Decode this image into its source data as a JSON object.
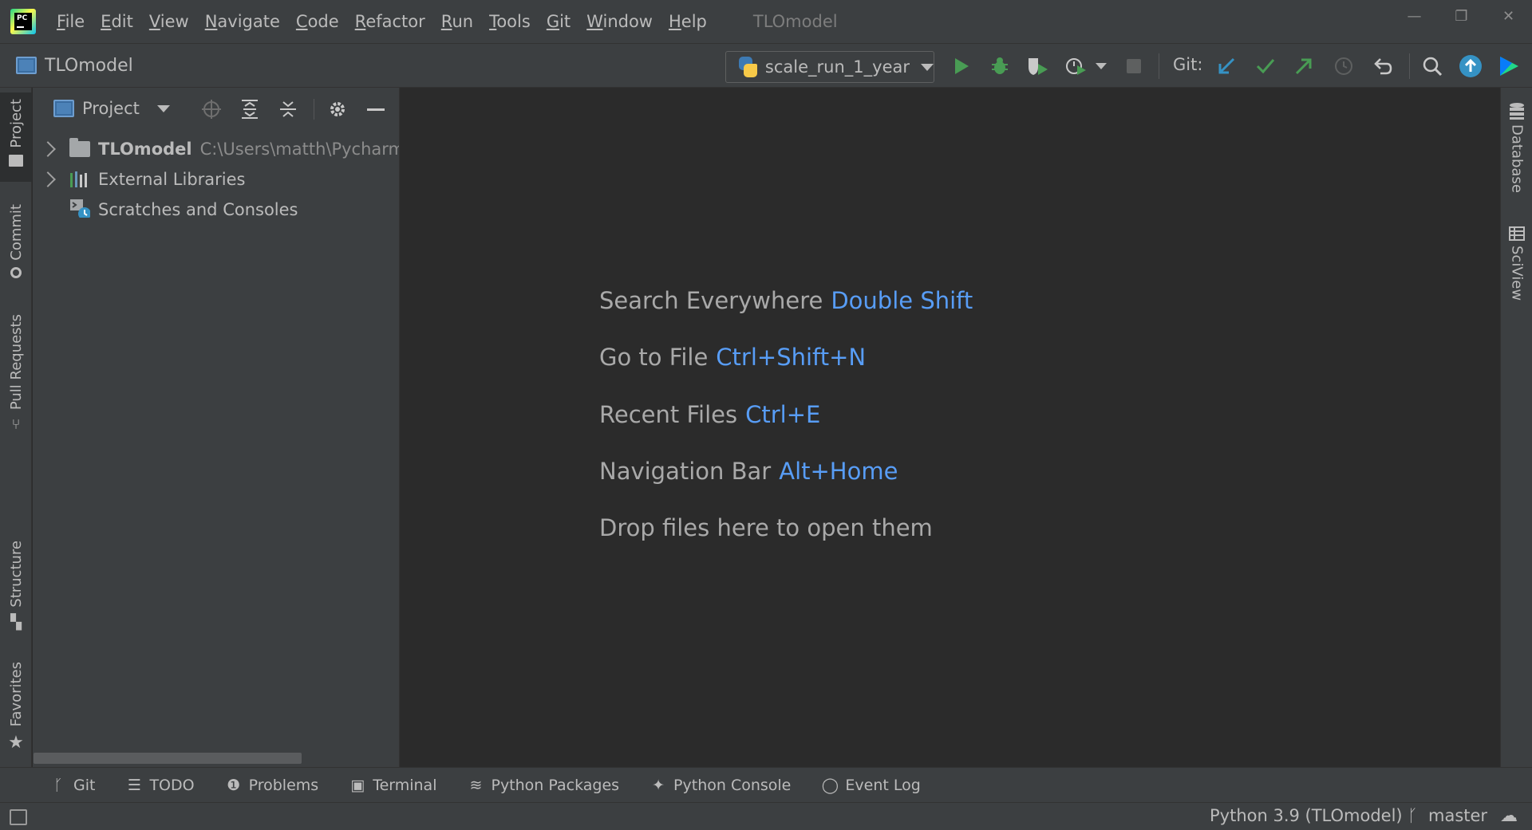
{
  "app": {
    "logo_text": "PC",
    "window_title": "TLOmodel"
  },
  "menu": {
    "items": [
      {
        "mnemonic": "F",
        "rest": "ile"
      },
      {
        "mnemonic": "E",
        "rest": "dit"
      },
      {
        "mnemonic": "V",
        "rest": "iew"
      },
      {
        "mnemonic": "N",
        "rest": "avigate"
      },
      {
        "mnemonic": "C",
        "rest": "ode"
      },
      {
        "mnemonic": "R",
        "rest": "efactor"
      },
      {
        "mnemonic": "R",
        "rest": "un"
      },
      {
        "mnemonic": "T",
        "rest": "ools"
      },
      {
        "mnemonic": "G",
        "rest": "it"
      },
      {
        "mnemonic": "W",
        "rest": "indow"
      },
      {
        "mnemonic": "H",
        "rest": "elp"
      }
    ]
  },
  "window_controls": {
    "minimize": "—",
    "restore": "❐",
    "close": "✕"
  },
  "navbar": {
    "breadcrumb": "TLOmodel",
    "run_config": "scale_run_1_year",
    "git_label": "Git:"
  },
  "left_tabs": {
    "project": "Project",
    "commit": "Commit",
    "pull_requests": "Pull Requests",
    "structure": "Structure",
    "favorites": "Favorites"
  },
  "right_tabs": {
    "database": "Database",
    "sciview": "SciView"
  },
  "project_panel": {
    "title": "Project",
    "tree": {
      "root_name": "TLOmodel",
      "root_path": "C:\\Users\\matth\\PycharmProjects\\TLOmodel",
      "external_libraries": "External Libraries",
      "scratches": "Scratches and Consoles"
    }
  },
  "editor": {
    "hints": [
      {
        "label": "Search Everywhere",
        "key": "Double Shift"
      },
      {
        "label": "Go to File",
        "key": "Ctrl+Shift+N"
      },
      {
        "label": "Recent Files",
        "key": "Ctrl+E"
      },
      {
        "label": "Navigation Bar",
        "key": "Alt+Home"
      }
    ],
    "drop_text": "Drop files here to open them"
  },
  "bottom_tabs": {
    "git": "Git",
    "todo": "TODO",
    "problems": "Problems",
    "terminal": "Terminal",
    "python_packages": "Python Packages",
    "python_console": "Python Console",
    "event_log": "Event Log"
  },
  "status_bar": {
    "interpreter": "Python 3.9 (TLOmodel)",
    "branch": "master"
  },
  "colors": {
    "background": "#2b2b2b",
    "panel": "#3c3f41",
    "text": "#bbbbbb",
    "shortcut": "#589df6",
    "run_green": "#499c54",
    "git_blue": "#3592c4"
  }
}
